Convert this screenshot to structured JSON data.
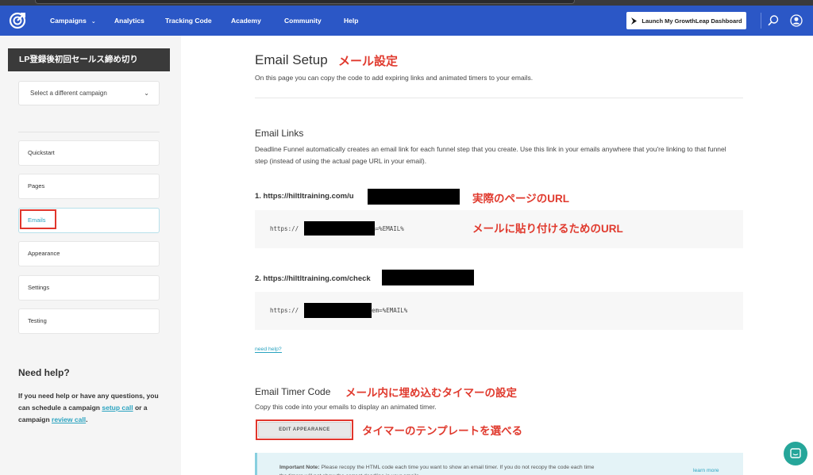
{
  "nav": {
    "items": [
      "Campaigns",
      "Analytics",
      "Tracking Code",
      "Academy",
      "Community",
      "Help"
    ],
    "campaigns_chevron": "chevron-down-icon",
    "launch_button": "Launch My GrowthLeap Dashboard"
  },
  "sidebar": {
    "campaign_title": "LP登録後初回セールス締め切り",
    "campaign_select": "Select a different campaign",
    "items": [
      "Quickstart",
      "Pages",
      "Emails",
      "Appearance",
      "Settings",
      "Testing"
    ],
    "active_item": "Emails",
    "help": {
      "title": "Need help?",
      "text_1": "If you need help or have any questions, you can schedule a campaign ",
      "link_1": "setup call",
      "text_2": " or a campaign ",
      "link_2": "review call",
      "text_3": "."
    }
  },
  "main": {
    "title": "Email Setup",
    "title_annotation": "メール設定",
    "subtitle": "On this page you can copy the code to add expiring links and animated timers to your emails.",
    "email_links": {
      "heading": "Email Links",
      "description": "Deadline Funnel automatically creates an email link for each funnel step that you create. Use this link in your emails anywhere that you're linking to that funnel step (instead of using the actual page URL in your email).",
      "link_1_label": "1. https://hiltltraining.com/u",
      "link_1_annotation": "実際のページのURL",
      "link_1_code_start": "https://",
      "link_1_code_end": "?em=%EMAIL%",
      "link_1_code_annotation": "メールに貼り付けるためのURL",
      "link_2_label": "2. https://hiltltraining.com/check",
      "link_2_code_start": "https://",
      "link_2_code_end": "2?em=%EMAIL%",
      "need_help": "need help?"
    },
    "timer": {
      "heading": "Email Timer Code",
      "heading_annotation": "メール内に埋め込むタイマーの設定",
      "description": "Copy this code into your emails to display an animated timer.",
      "edit_button": "EDIT APPEARANCE",
      "edit_annotation": "タイマーのテンプレートを選べる",
      "note_bold": "Important Note:",
      "note_text": " Please recopy the HTML code each time you want to show an email timer. If you do not recopy the code each time the timers will not show the correct deadline in your emails.",
      "learn_more": "learn more"
    }
  },
  "colors": {
    "nav_bg": "#2b57c6",
    "accent": "#2aa3c0",
    "annotation": "#e03a2e",
    "chat": "#26a69a"
  }
}
